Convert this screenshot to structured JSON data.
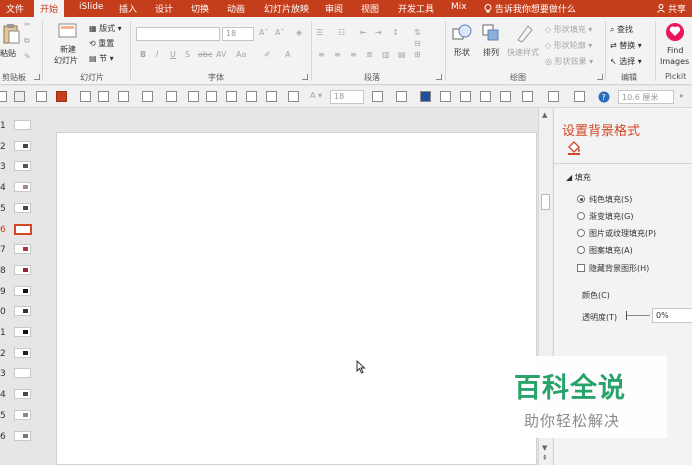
{
  "tabs": [
    "文件",
    "开始",
    "iSlide",
    "插入",
    "设计",
    "切换",
    "动画",
    "幻灯片放映",
    "审阅",
    "视图",
    "开发工具",
    "Mix"
  ],
  "active_tab": "开始",
  "tell_me": "告诉我你想要做什么",
  "share": "共享",
  "ribbon": {
    "clipboard": {
      "paste": "粘贴",
      "label": "剪贴板"
    },
    "slides": {
      "new_slide_1": "新建",
      "new_slide_2": "幻灯片",
      "layout": "版式",
      "reset": "重置",
      "section": "节",
      "label": "幻灯片"
    },
    "font": {
      "size": "18",
      "label": "字体",
      "bold": "B",
      "italic": "I",
      "underline": "U",
      "strike": "S",
      "abc": "abc",
      "av": "AV",
      "aa": "Aa"
    },
    "paragraph": {
      "label": "段落"
    },
    "drawing": {
      "shape": "形状",
      "arrange": "排列",
      "quick_styles": "快速样式",
      "shape_fill": "形状填充",
      "shape_outline": "形状轮廓",
      "shape_effects": "形状效果",
      "label": "绘图"
    },
    "editing": {
      "find": "查找",
      "replace": "替换",
      "select": "选择",
      "label": "编辑"
    },
    "pickit": {
      "find": "Find",
      "images": "Images",
      "label": "Pickit"
    }
  },
  "qat": {
    "font_size": "18",
    "measure": "10.6 厘米"
  },
  "slide_thumbs": [
    {
      "num": "1",
      "active": false
    },
    {
      "num": "2",
      "active": false
    },
    {
      "num": "3",
      "active": false
    },
    {
      "num": "4",
      "active": false
    },
    {
      "num": "5",
      "active": false
    },
    {
      "num": "6",
      "active": true
    },
    {
      "num": "7",
      "active": false
    },
    {
      "num": "8",
      "active": false
    },
    {
      "num": "9",
      "active": false
    },
    {
      "num": "0",
      "active": false
    },
    {
      "num": "1",
      "active": false
    },
    {
      "num": "2",
      "active": false
    },
    {
      "num": "3",
      "active": false
    },
    {
      "num": "4",
      "active": false
    },
    {
      "num": "5",
      "active": false
    },
    {
      "num": "6",
      "active": false
    }
  ],
  "pane": {
    "title": "设置背景格式",
    "section": "填充",
    "options": [
      {
        "label": "纯色填充(S)",
        "selected": true
      },
      {
        "label": "渐变填充(G)",
        "selected": false
      },
      {
        "label": "图片或纹理填充(P)",
        "selected": false
      },
      {
        "label": "图案填充(A)",
        "selected": false
      }
    ],
    "hide_bg": "隐藏背景图形(H)",
    "color_label": "颜色(C)",
    "transparency_label": "透明度(T)",
    "transparency_value": "0%"
  },
  "watermark": {
    "title": "百科全说",
    "subtitle": "助你轻松解决"
  },
  "colors": {
    "accent": "#c43e1c",
    "pane_title": "#d24726",
    "watermark": "#2aa36b"
  }
}
